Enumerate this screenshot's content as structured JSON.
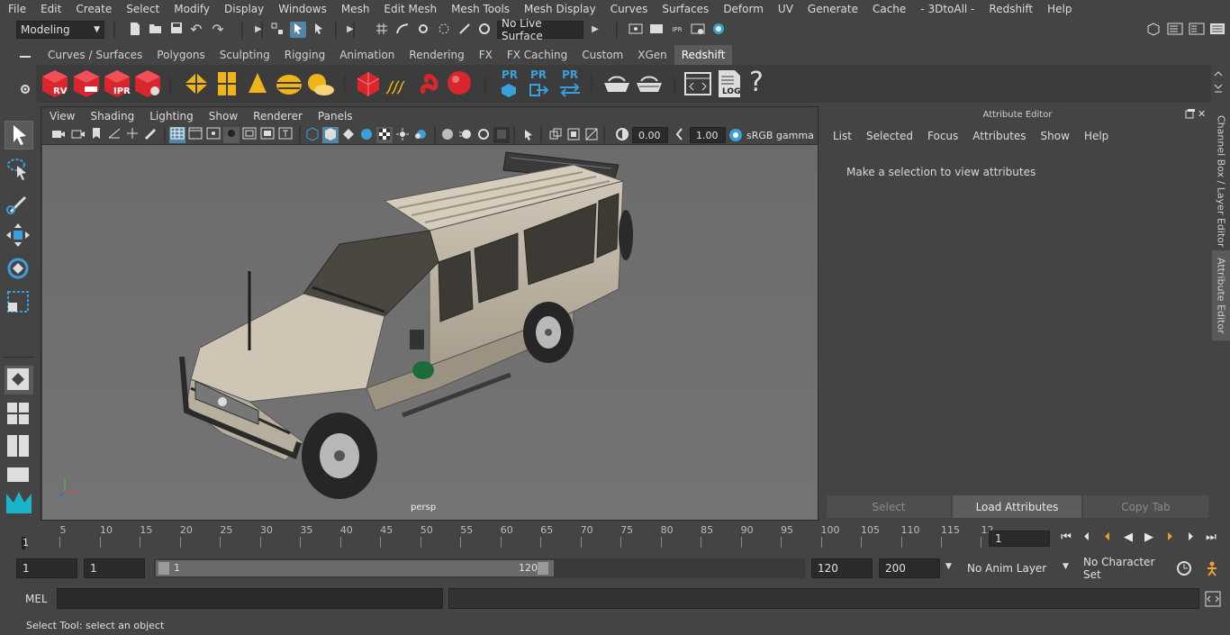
{
  "menubar": [
    "File",
    "Edit",
    "Create",
    "Select",
    "Modify",
    "Display",
    "Windows",
    "Mesh",
    "Edit Mesh",
    "Mesh Tools",
    "Mesh Display",
    "Curves",
    "Surfaces",
    "Deform",
    "UV",
    "Generate",
    "Cache",
    "- 3DtoAll -",
    "Redshift",
    "Help"
  ],
  "status": {
    "mode": "Modeling",
    "live_surface": "No Live Surface"
  },
  "shelf_tabs": [
    "Curves / Surfaces",
    "Polygons",
    "Sculpting",
    "Rigging",
    "Animation",
    "Rendering",
    "FX",
    "FX Caching",
    "Custom",
    "XGen",
    "Redshift"
  ],
  "shelf_active_tab": "Redshift",
  "shelf_labels": {
    "rv": "RV",
    "ipr": "IPR",
    "pr1": "PR",
    "pr2": "PR",
    "pr3": "PR",
    "log": "LOG",
    "help": "?"
  },
  "viewport": {
    "menu": [
      "View",
      "Shading",
      "Lighting",
      "Show",
      "Renderer",
      "Panels"
    ],
    "exposure": "0.00",
    "gamma": "1.00",
    "colorspace": "sRGB gamma",
    "camera": "persp"
  },
  "attribute_editor": {
    "title": "Attribute Editor",
    "menu": [
      "List",
      "Selected",
      "Focus",
      "Attributes",
      "Show",
      "Help"
    ],
    "message": "Make a selection to view attributes",
    "buttons": {
      "select": "Select",
      "load": "Load Attributes",
      "copy": "Copy Tab"
    }
  },
  "side_tabs": {
    "channel_box": "Channel Box / Layer Editor",
    "attribute_editor": "Attribute Editor"
  },
  "timeline": {
    "ticks": [
      "5",
      "10",
      "15",
      "20",
      "25",
      "30",
      "35",
      "40",
      "45",
      "50",
      "55",
      "60",
      "65",
      "70",
      "75",
      "80",
      "85",
      "90",
      "95",
      "100",
      "105",
      "110",
      "115",
      "12"
    ],
    "start_marker": "1",
    "current_frame": "1"
  },
  "range": {
    "start": "1",
    "playback_start": "1",
    "slider_start": "1",
    "slider_end": "120",
    "playback_end": "120",
    "end": "200",
    "anim_layer": "No Anim Layer",
    "character_set": "No Character Set"
  },
  "command_line": {
    "label": "MEL"
  },
  "help_line": "Select Tool: select an object",
  "colors": {
    "accent": "#5285a6",
    "redshift_red": "#d9262c",
    "cube_yellow": "#f0b418"
  }
}
